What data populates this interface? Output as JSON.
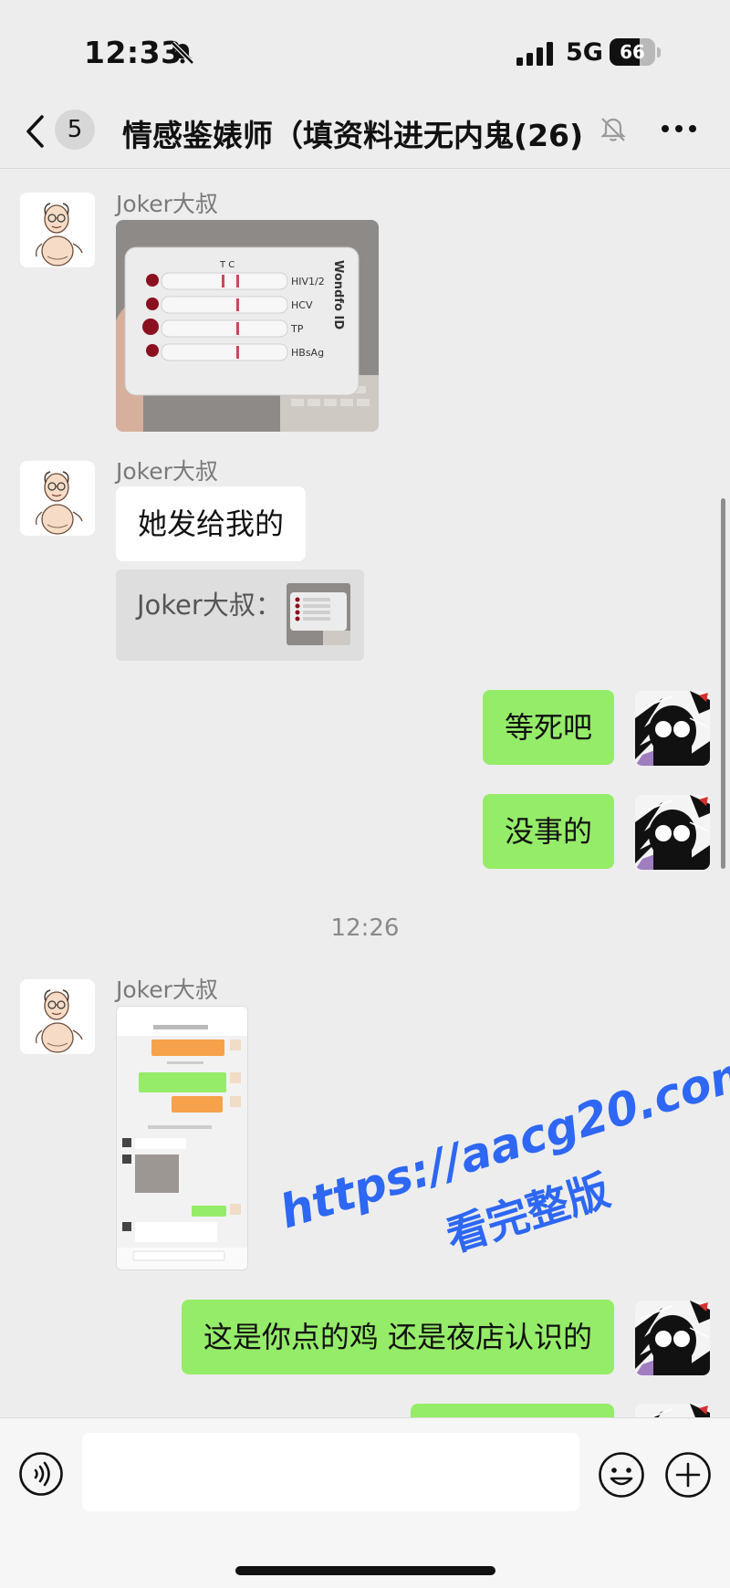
{
  "status_bar": {
    "time": "12:33",
    "network": "5G",
    "battery": "66",
    "battery_level": 0.66
  },
  "nav": {
    "unread_count": "5",
    "title": "情感鉴婊师（填资料进无内鬼",
    "member_count": "(26)"
  },
  "messages": {
    "m1": {
      "sender": "Joker大叔"
    },
    "m2": {
      "sender": "Joker大叔",
      "text": "她发给我的",
      "quote_label": "Joker大叔："
    },
    "m3": {
      "text": "等死吧"
    },
    "m4": {
      "text": "没事的"
    },
    "timestamp": "12:26",
    "m5": {
      "sender": "Joker大叔"
    },
    "m6": {
      "text": "这是你点的鸡 还是夜店认识的"
    }
  },
  "photo": {
    "tc": "T  C",
    "labels": [
      "HIV1/2",
      "HCV",
      "TP",
      "HBsAg"
    ],
    "brand": "Wondfo ID"
  },
  "watermark": {
    "line1": "https://aacg20.com",
    "line2": "看完整版"
  },
  "colors": {
    "green_bubble": "#95ec69",
    "background": "#ededed",
    "watermark": "#2d67f3"
  }
}
